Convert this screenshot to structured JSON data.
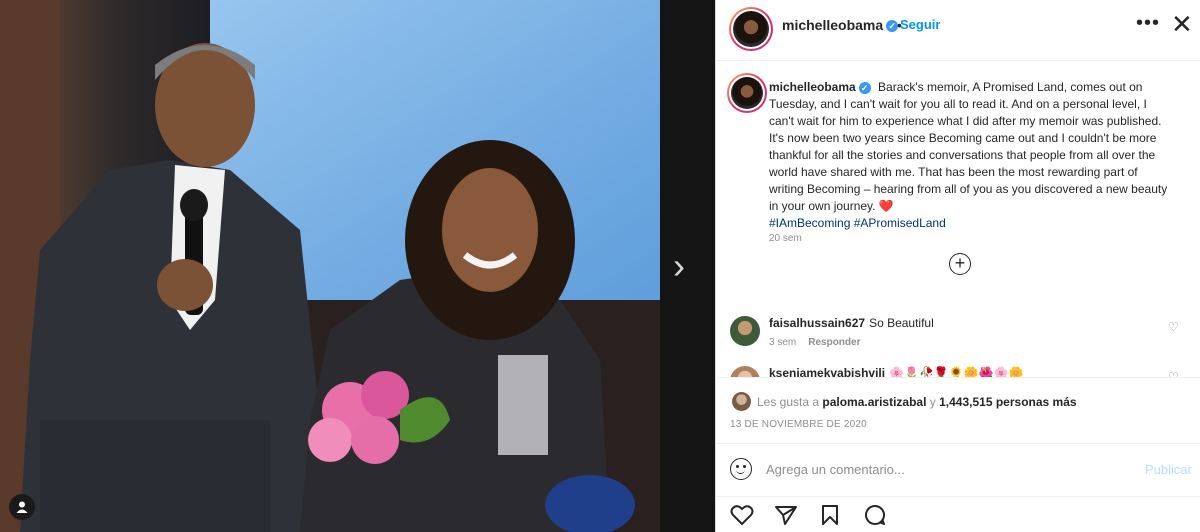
{
  "post": {
    "username": "michelleobama",
    "follow_label": "Seguir",
    "more_icon": "more-horizontal-icon",
    "close_icon": "close-icon",
    "separator": "•"
  },
  "media": {
    "next_arrow": "›",
    "user_tag_icon": "user-tag-icon"
  },
  "caption": {
    "username": "michelleobama",
    "text": "Barack's memoir, A Promised Land, comes out on Tuesday, and I can't wait for you all to read it. And on a personal level, I can't wait for him to experience what I did after my memoir was published. It's now been two years since Becoming came out and I couldn't be more thankful for all the stories and conversations that people from all over the world have shared with me. That has been the most rewarding part of writing Becoming – hearing from all of you as you discovered a new beauty in your own journey. ",
    "heart": "❤️",
    "hashtags": "#IAmBecoming #APromisedLand",
    "time": "20 sem",
    "load_more": "+"
  },
  "comments": [
    {
      "username": "faisalhussain627",
      "text": "So Beautiful",
      "time": "3 sem",
      "reply_label": "Responder",
      "like_icon": "♡"
    },
    {
      "username": "kseniamekvabishvili",
      "text": "🌸🌷🥀🌹🌻🌼🌺🌸🌼",
      "like_icon": "♡"
    }
  ],
  "likes": {
    "prefix": "Les gusta a",
    "user": "paloma.aristizabal",
    "middle": "y",
    "count": "1,443,515 personas más"
  },
  "date": "13 DE NOVIEMBRE DE 2020",
  "composer": {
    "placeholder": "Agrega un comentario...",
    "publish_label": "Publicar"
  },
  "colors": {
    "link_blue": "#0095f6",
    "verified_blue": "#3897f0",
    "publish_disabled": "#b2dffc",
    "hashtag": "#00376b"
  }
}
